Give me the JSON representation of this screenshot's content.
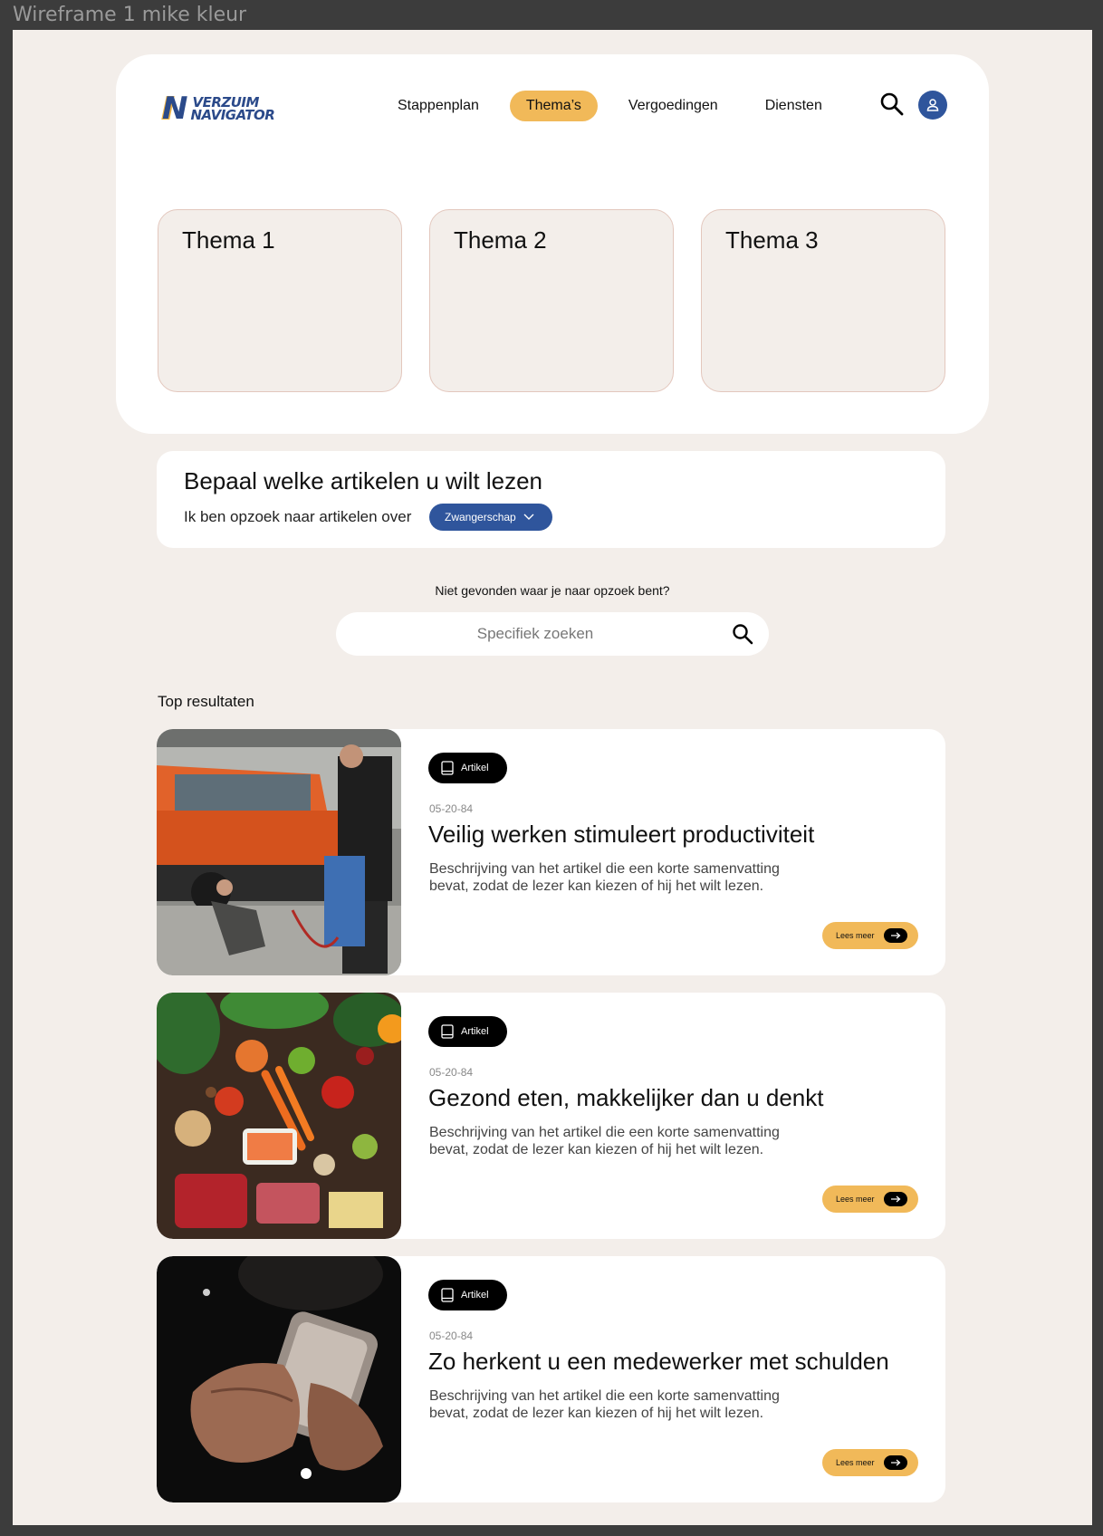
{
  "frame_label": "Wireframe 1 mike kleur",
  "logo": {
    "mark": "N",
    "line1": "VERZUIM",
    "line2": "NAVIGATOR"
  },
  "nav": [
    "Stappenplan",
    "Thema’s",
    "Vergoedingen",
    "Diensten"
  ],
  "nav_active": "Thema’s",
  "themes": [
    "Thema 1",
    "Thema 2",
    "Thema 3"
  ],
  "filter": {
    "heading": "Bepaal welke artikelen u wilt lezen",
    "sentence": "Ik ben opzoek naar artikelen over",
    "selected": "Zwangerschap"
  },
  "search": {
    "prompt": "Niet gevonden waar je naar opzoek bent?",
    "placeholder": "Specifiek zoeken"
  },
  "results_heading": "Top resultaten",
  "results": [
    {
      "badge": "Artikel",
      "date": "05-20-84",
      "title": "Veilig werken stimuleert productiviteit",
      "description": "Beschrijving van het artikel die een korte samenvatting bevat, zodat de lezer kan kiezen of hij het wilt lezen.",
      "cta": "Lees meer"
    },
    {
      "badge": "Artikel",
      "date": "05-20-84",
      "title": "Gezond eten, makkelijker dan u denkt",
      "description": "Beschrijving van het artikel die een korte samenvatting bevat, zodat de lezer kan kiezen of hij het wilt lezen.",
      "cta": "Lees meer"
    },
    {
      "badge": "Artikel",
      "date": "05-20-84",
      "title": "Zo herkent u een medewerker met schulden",
      "description": "Beschrijving van het artikel die een korte samenvatting bevat, zodat de lezer kan kiezen of hij het wilt lezen.",
      "cta": "Lees meer"
    }
  ],
  "colors": {
    "brand_blue": "#2f559c",
    "accent_yellow": "#f1b959",
    "background": "#f3eeea"
  }
}
